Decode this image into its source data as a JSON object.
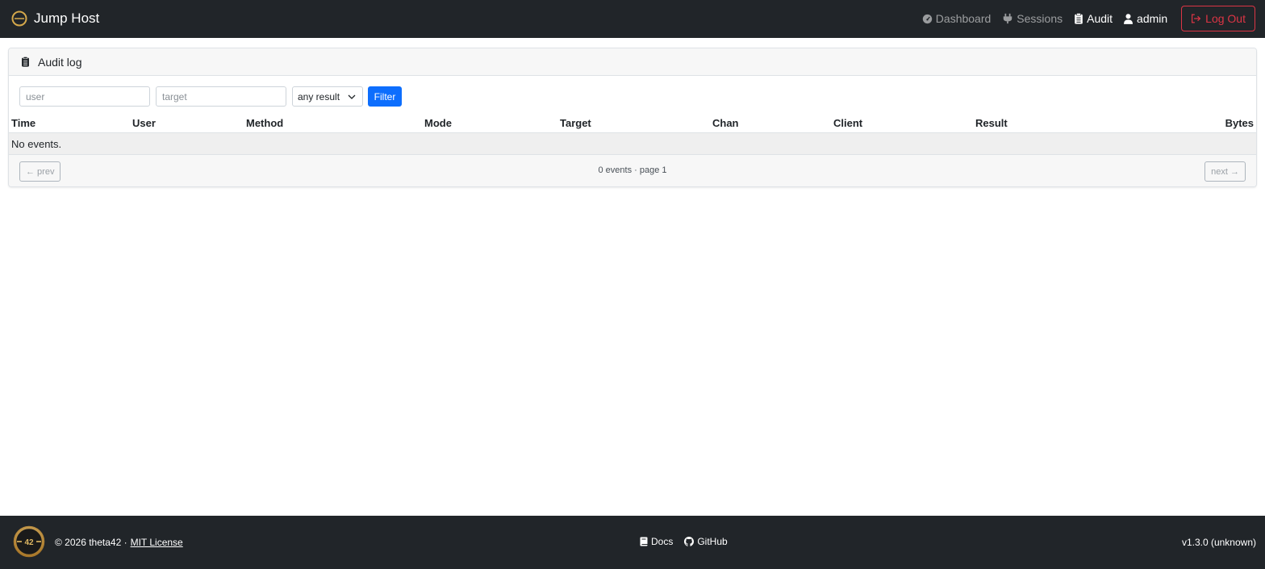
{
  "app": {
    "title": "Jump Host"
  },
  "nav": {
    "dashboard": "Dashboard",
    "sessions": "Sessions",
    "audit": "Audit",
    "user": "admin",
    "logout": "Log Out"
  },
  "card": {
    "title": "Audit log"
  },
  "filters": {
    "user_placeholder": "user",
    "target_placeholder": "target",
    "result_selected": "any result",
    "filter_button": "Filter"
  },
  "table": {
    "columns": [
      "Time",
      "User",
      "Method",
      "Mode",
      "Target",
      "Chan",
      "Client",
      "Result",
      "Bytes"
    ],
    "empty_text": "No events."
  },
  "pagination": {
    "prev": "← prev",
    "next": "next →",
    "info": "0 events · page 1"
  },
  "footer": {
    "logo_text": "42",
    "copyright": "© 2026 theta42 ·",
    "license": "MIT License",
    "docs": "Docs",
    "github": "GitHub",
    "version": "v1.3.0 (unknown)"
  },
  "colors": {
    "navbar_bg": "#212529",
    "primary": "#0d6efd",
    "danger": "#dc3545",
    "logo_gold": "#c9a24a"
  }
}
